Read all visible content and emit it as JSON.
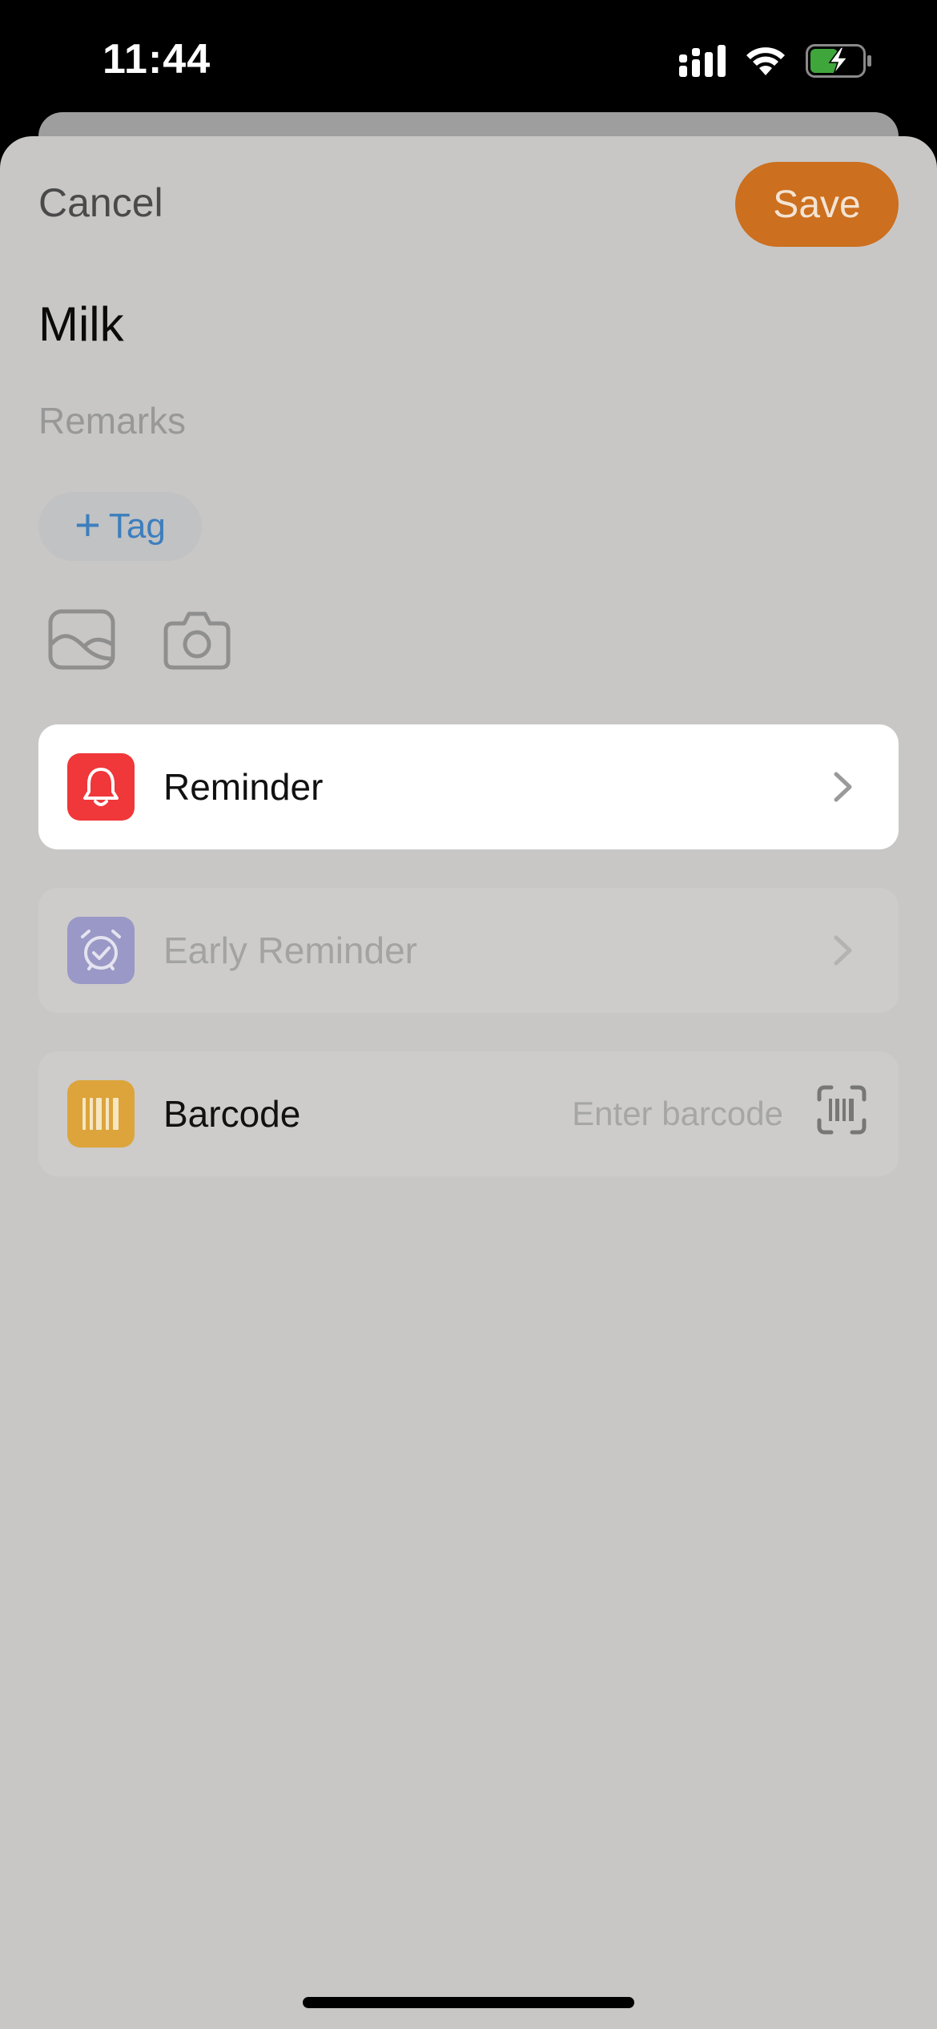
{
  "status_bar": {
    "time": "11:44",
    "icons": [
      "cellular-signal-icon",
      "wifi-icon",
      "battery-charging-icon"
    ],
    "battery_color": "#3fa63c"
  },
  "header": {
    "cancel_label": "Cancel",
    "save_label": "Save",
    "save_color": "#cc6f1e"
  },
  "item": {
    "name": "Milk",
    "remarks_placeholder": "Remarks",
    "tag_label": "Tag"
  },
  "media": {
    "icons": [
      "photo-library-icon",
      "camera-icon"
    ]
  },
  "rows": {
    "reminder": {
      "label": "Reminder",
      "icon": "bell-icon",
      "color": "#f0373a"
    },
    "early_reminder": {
      "label": "Early Reminder",
      "icon": "alarm-clock-icon",
      "color": "#9a98c6"
    },
    "barcode": {
      "label": "Barcode",
      "icon": "barcode-icon",
      "color": "#dca43a",
      "placeholder": "Enter barcode",
      "scan_icon": "barcode-scan-icon"
    }
  }
}
